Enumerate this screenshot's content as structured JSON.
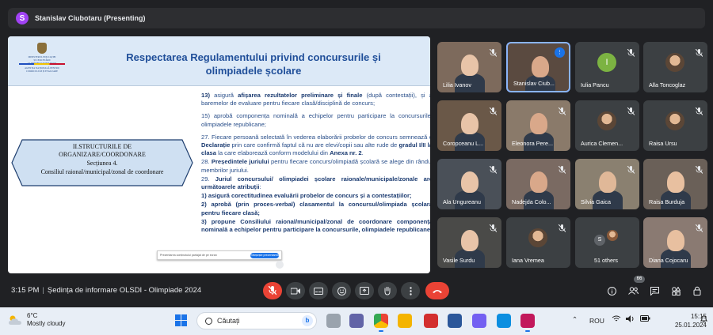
{
  "banner": {
    "avatar_letter": "S",
    "text": "Stanislav Ciubotaru (Presenting)"
  },
  "slide": {
    "logo_lines": [
      "MINISTERUL EDUCAȚIEI",
      "ȘI CERCETĂRII",
      "AL REPUBLICII MOLDOVA",
      "AGENȚIA NAȚIONALĂ PENTRU",
      "CURRICULUM ȘI EVALUARE"
    ],
    "title_line1": "Respectarea Regulamentului privind concursurile și",
    "title_line2": "olimpiadele școlare",
    "box": {
      "line1": "II.STRUCTURILE DE",
      "line2": "ORGANIZARE/COORDONARE",
      "line3": "Secțiunea 4.",
      "line4": "Consiliul raional/municipal/zonal de coordonare"
    },
    "p13_num": "13)",
    "p13_a": "asigură ",
    "p13_b": "afișarea rezultatelor preliminare și finale",
    "p13_c": " (după contestații), și a baremelor de evaluare pentru fiecare clasă/disciplină de concurs;",
    "p15": "15) aprobă componența nominală a echipelor pentru participare la concursurile, olimpiadele republicane;",
    "p27_a": "27. Fiecare persoană selectată în vederea elaborării probelor de concurs semnează o ",
    "p27_b": "Declarație",
    "p27_c": " prin care confirmă faptul că nu are elevi/copii sau alte rude de ",
    "p27_d": "gradul I/II la clasa",
    "p27_e": " la care elaborează conform modelului din ",
    "p27_f": "Anexa nr. 2",
    "p27_g": ".",
    "p28_a": "28. ",
    "p28_b": "Președintele juriului",
    "p28_c": " pentru fiecare concurs/olimpiadă școlară se alege din rândul membrilor juriului.",
    "p29_a": "29. ",
    "p29_b": "Juriul concursului/ olimpiadei școlare raionale/municipale/zonale are următoarele atribuții",
    "p29_c": ":",
    "p29_1": "1) asigură corectitudinea evaluării probelor de concurs și a contestațiilor;",
    "p29_2": "2) aprobă (prin proces-verbal) clasamentul la concursul/olimpiada școlară pentru fiecare clasă;",
    "p29_3": "3)     propune     Consiliului     raional/municipal/zonal     de     coordonare componența nominală a echipelor pentru participare la concursurile, olimpiadele republicane;",
    "tooltip_text": "Prezentarea conținutului partajat de pe ecran",
    "tooltip_button": "Sfârșește prezentarea"
  },
  "participants": [
    {
      "name": "Lilia Ivanov",
      "type": "photo",
      "muted": true
    },
    {
      "name": "Stanislav Ciub...",
      "type": "photo",
      "speaking": true
    },
    {
      "name": "Iulia Pancu",
      "type": "avatar",
      "letter": "I",
      "color": "#7cb342",
      "muted": true
    },
    {
      "name": "Alla Toncoglaz",
      "type": "avatar-photo",
      "muted": true
    },
    {
      "name": "Coropceanu L...",
      "type": "photo",
      "muted": true
    },
    {
      "name": "Eleonora Pere...",
      "type": "photo",
      "muted": true
    },
    {
      "name": "Aurica Clemen...",
      "type": "avatar-photo",
      "muted": true
    },
    {
      "name": "Raisa Ursu",
      "type": "avatar-photo",
      "muted": true
    },
    {
      "name": "Ala Ungureanu",
      "type": "photo",
      "muted": true
    },
    {
      "name": "Nadejda Colo...",
      "type": "photo",
      "muted": true
    },
    {
      "name": "Silvia Gaica",
      "type": "photo",
      "muted": true
    },
    {
      "name": "Raisa Burduja",
      "type": "photo",
      "muted": true
    },
    {
      "name": "Vasile Surdu",
      "type": "photo",
      "muted": true
    },
    {
      "name": "Iana Vremea",
      "type": "avatar-photo",
      "muted": true
    },
    {
      "name": "51 others",
      "type": "others"
    },
    {
      "name": "Diana Cojocaru",
      "type": "photo",
      "muted": true
    }
  ],
  "others": {
    "letter": "S"
  },
  "meeting": {
    "time": "3:15 PM",
    "separator": "|",
    "title": "Ședința de informare OLSDI - Olimpiade 2024",
    "people_count": "66"
  },
  "taskbar": {
    "weather_temp": "6°C",
    "weather_desc": "Mostly cloudy",
    "search_placeholder": "Căutați",
    "language": "ROU",
    "clock_time": "15:15",
    "clock_date": "25.01.2024"
  },
  "colors": {
    "accent": "#1a73e8",
    "end_call": "#ea4335",
    "title_blue": "#1f4e99"
  }
}
